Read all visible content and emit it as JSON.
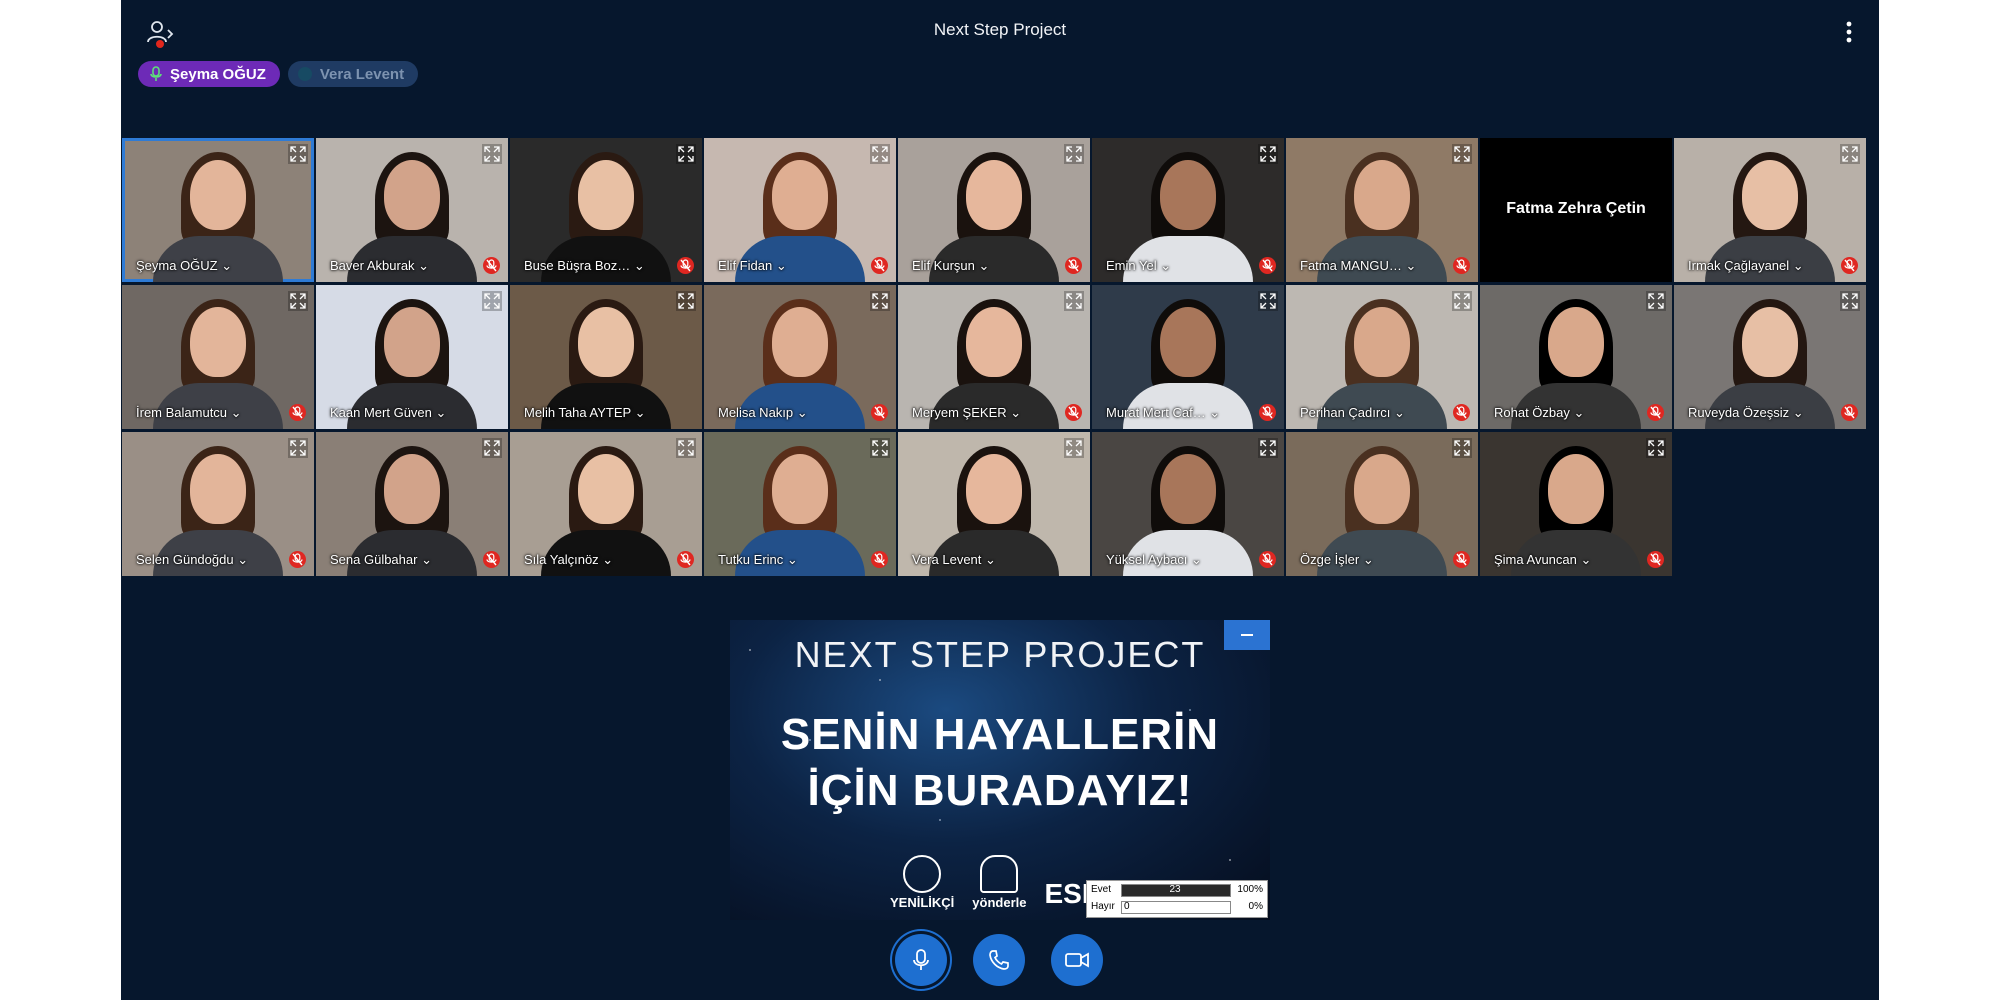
{
  "meeting": {
    "title": "Next Step Project"
  },
  "talkers": [
    {
      "name": "Şeyma OĞUZ",
      "active": true
    },
    {
      "name": "Vera Levent",
      "active": false
    }
  ],
  "participants": [
    {
      "name": "Şeyma OĞUZ",
      "muted": false,
      "self": true
    },
    {
      "name": "Baver Akburak",
      "muted": true
    },
    {
      "name": "Buse Büşra Boz…",
      "muted": true
    },
    {
      "name": "Elif Fidan",
      "muted": true
    },
    {
      "name": "Elif Kurşun",
      "muted": true
    },
    {
      "name": "Emin Yel",
      "muted": true
    },
    {
      "name": "Fatma MANGU…",
      "muted": true
    },
    {
      "name": "Fatma Zehra Çetin",
      "camera_off": true
    },
    {
      "name": "Irmak Çağlayanel",
      "muted": true
    },
    {
      "name": "İrem Balamutcu",
      "muted": true
    },
    {
      "name": "Kaan Mert Güven",
      "muted": false
    },
    {
      "name": "Melih Taha AYTEP",
      "muted": false
    },
    {
      "name": "Melisa Nakıp",
      "muted": true
    },
    {
      "name": "Meryem ŞEKER",
      "muted": true
    },
    {
      "name": "Murat Mert Caf…",
      "muted": true
    },
    {
      "name": "Perihan Çadırcı",
      "muted": true
    },
    {
      "name": "Rohat Özbay",
      "muted": true
    },
    {
      "name": "Ruveyda Özeşsiz",
      "muted": true
    },
    {
      "name": "Selen Gündoğdu",
      "muted": true
    },
    {
      "name": "Sena Gülbahar",
      "muted": true
    },
    {
      "name": "Sıla Yalçınöz",
      "muted": true
    },
    {
      "name": "Tutku Erinc",
      "muted": true
    },
    {
      "name": "Vera Levent",
      "muted": false
    },
    {
      "name": "Yüksel Aybacı",
      "muted": true
    },
    {
      "name": "Özge İşler",
      "muted": true
    },
    {
      "name": "Şima Avuncan",
      "muted": true
    }
  ],
  "presentation": {
    "title": "NEXT STEP PROJECT",
    "line1": "SENİN HAYALLERİN",
    "line2": "İÇİN BURADAYIZ!",
    "logos": [
      "YENİLİKÇİ",
      "yönderle",
      "ESN"
    ]
  },
  "poll": [
    {
      "option": "Evet",
      "count": "23",
      "percent": "100%",
      "fraction": 1.0
    },
    {
      "option": "Hayır",
      "count": "0",
      "percent": "0%",
      "fraction": 0.0
    }
  ],
  "colors": {
    "background": "#06172d",
    "accent": "#1e6fd0",
    "talker_active": "#6d2ab7",
    "muted_red": "#df2721"
  },
  "icons": {
    "users": "users-icon",
    "more": "more-vertical-icon",
    "mic": "microphone-icon",
    "phone": "phone-icon",
    "video": "video-camera-icon",
    "expand": "expand-icon",
    "muted": "mic-muted-icon"
  }
}
